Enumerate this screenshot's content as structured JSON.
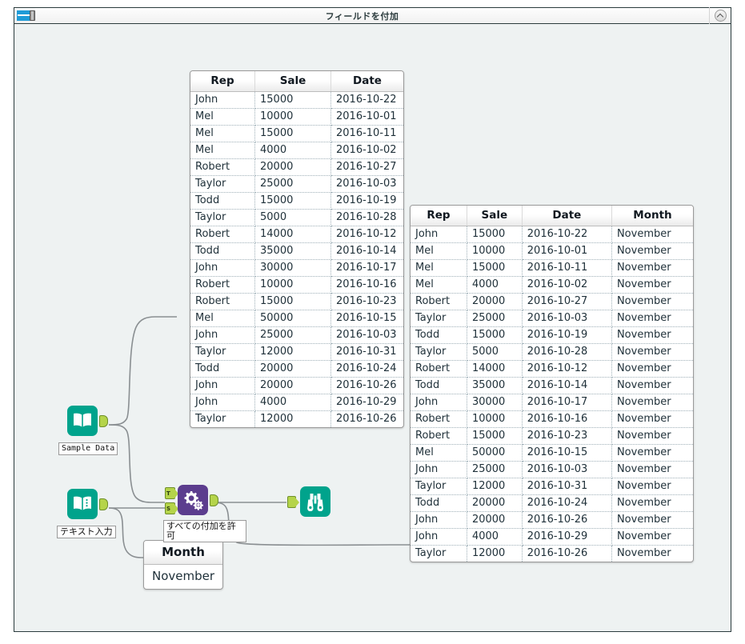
{
  "window": {
    "title": "フィールドを付加",
    "icon": "append-fields-icon",
    "collapse_icon": "chevron-up-circle-icon"
  },
  "tools": [
    {
      "id": "sample-data",
      "label": "Sample Data",
      "icon": "open-book-icon",
      "color": "#00a38c"
    },
    {
      "id": "text-input",
      "label": "テキスト入力",
      "icon": "open-book-dots-icon",
      "color": "#00a38c"
    },
    {
      "id": "append-fields",
      "label": "すべての付加を許可",
      "icon": "gears-icon",
      "color": "#5c3d8e",
      "input_t": "T",
      "input_s": "S"
    },
    {
      "id": "browse",
      "label": "",
      "icon": "binoculars-icon",
      "color": "#00a38c"
    }
  ],
  "source_table": {
    "headers": [
      "Rep",
      "Sale",
      "Date"
    ],
    "rows": [
      [
        "John",
        "15000",
        "2016-10-22"
      ],
      [
        "Mel",
        "10000",
        "2016-10-01"
      ],
      [
        "Mel",
        "15000",
        "2016-10-11"
      ],
      [
        "Mel",
        "4000",
        "2016-10-02"
      ],
      [
        "Robert",
        "20000",
        "2016-10-27"
      ],
      [
        "Taylor",
        "25000",
        "2016-10-03"
      ],
      [
        "Todd",
        "15000",
        "2016-10-19"
      ],
      [
        "Taylor",
        "5000",
        "2016-10-28"
      ],
      [
        "Robert",
        "14000",
        "2016-10-12"
      ],
      [
        "Todd",
        "35000",
        "2016-10-14"
      ],
      [
        "John",
        "30000",
        "2016-10-17"
      ],
      [
        "Robert",
        "10000",
        "2016-10-16"
      ],
      [
        "Robert",
        "15000",
        "2016-10-23"
      ],
      [
        "Mel",
        "50000",
        "2016-10-15"
      ],
      [
        "John",
        "25000",
        "2016-10-03"
      ],
      [
        "Taylor",
        "12000",
        "2016-10-31"
      ],
      [
        "Todd",
        "20000",
        "2016-10-24"
      ],
      [
        "John",
        "20000",
        "2016-10-26"
      ],
      [
        "John",
        "4000",
        "2016-10-29"
      ],
      [
        "Taylor",
        "12000",
        "2016-10-26"
      ]
    ]
  },
  "month_table": {
    "headers": [
      "Month"
    ],
    "rows": [
      [
        "November"
      ]
    ]
  },
  "output_table": {
    "headers": [
      "Rep",
      "Sale",
      "Date",
      "Month"
    ],
    "rows": [
      [
        "John",
        "15000",
        "2016-10-22",
        "November"
      ],
      [
        "Mel",
        "10000",
        "2016-10-01",
        "November"
      ],
      [
        "Mel",
        "15000",
        "2016-10-11",
        "November"
      ],
      [
        "Mel",
        "4000",
        "2016-10-02",
        "November"
      ],
      [
        "Robert",
        "20000",
        "2016-10-27",
        "November"
      ],
      [
        "Taylor",
        "25000",
        "2016-10-03",
        "November"
      ],
      [
        "Todd",
        "15000",
        "2016-10-19",
        "November"
      ],
      [
        "Taylor",
        "5000",
        "2016-10-28",
        "November"
      ],
      [
        "Robert",
        "14000",
        "2016-10-12",
        "November"
      ],
      [
        "Todd",
        "35000",
        "2016-10-14",
        "November"
      ],
      [
        "John",
        "30000",
        "2016-10-17",
        "November"
      ],
      [
        "Robert",
        "10000",
        "2016-10-16",
        "November"
      ],
      [
        "Robert",
        "15000",
        "2016-10-23",
        "November"
      ],
      [
        "Mel",
        "50000",
        "2016-10-15",
        "November"
      ],
      [
        "John",
        "25000",
        "2016-10-03",
        "November"
      ],
      [
        "Taylor",
        "12000",
        "2016-10-31",
        "November"
      ],
      [
        "Todd",
        "20000",
        "2016-10-24",
        "November"
      ],
      [
        "John",
        "20000",
        "2016-10-26",
        "November"
      ],
      [
        "John",
        "4000",
        "2016-10-29",
        "November"
      ],
      [
        "Taylor",
        "12000",
        "2016-10-26",
        "November"
      ]
    ]
  },
  "colors": {
    "canvas": "#eef2f2",
    "tool_teal": "#00a38c",
    "tool_purple": "#5c3d8e",
    "anchor": "#b5d44a",
    "border": "#2b3b3d"
  }
}
